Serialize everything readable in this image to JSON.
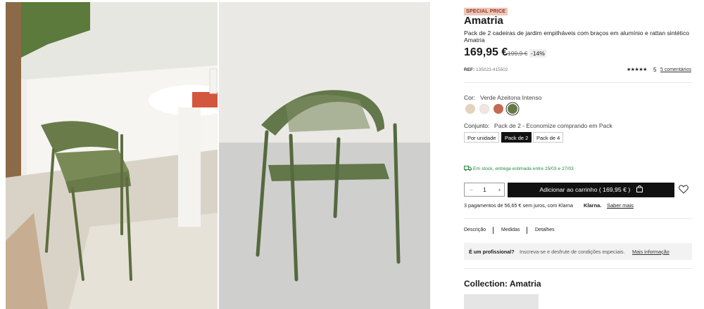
{
  "images": [
    {
      "name": "lifestyle-photo",
      "colors": {
        "sky": "#e9e8e3",
        "wall": "#f3f2ee",
        "floor": "#d8d3c8",
        "chair": "#6a7b4a"
      }
    },
    {
      "name": "studio-photo",
      "colors": {
        "backdrop": "#e8e6e2",
        "floor": "#cfcfce",
        "chair": "#62774a"
      }
    }
  ],
  "product": {
    "badge": "SPECIAL PRICE",
    "title": "Amatria",
    "subtitle": "Pack de 2 cadeiras de jardim empilháveis com braços em alumínio e rattan sintético Amatria",
    "price": "169,95 €",
    "old_price": "199,9 €",
    "discount": "-14%",
    "ref_label": "REF:",
    "ref_value": "135023-415502",
    "stars": "★★★★★",
    "rating": "5",
    "reviews": "5 comentários"
  },
  "color": {
    "label": "Cor:",
    "value": "Verde Azeitona Intenso",
    "swatches": [
      {
        "name": "beige",
        "hex": "#e3d3bc"
      },
      {
        "name": "cream",
        "hex": "#f3e6e2"
      },
      {
        "name": "terracotta",
        "hex": "#c56a52"
      },
      {
        "name": "olive-green",
        "hex": "#667a47",
        "selected": true
      }
    ]
  },
  "set": {
    "label": "Conjunto:",
    "value": "Pack de 2 - Economize comprando em Pack",
    "options": [
      "Por unidade",
      "Pack de 2",
      "Pack de 4"
    ],
    "selected": "Pack de 2"
  },
  "stock": {
    "text": "Em stock, entrega estimada entre 25/03 e 27/03",
    "color": "#1f8a3b"
  },
  "quantity": {
    "minus": "−",
    "value": "1",
    "plus": "+"
  },
  "cart": {
    "label": "Adicionar ao carrinho ( 169,95 € )"
  },
  "klarna": {
    "text": "3 pagamentos de 56,65 € sem juros, com Klarna",
    "logo": "Klarna.",
    "link": "Saber mais"
  },
  "tabs": [
    "Descrição",
    "Medidas",
    "Detalhes"
  ],
  "pro": {
    "question": "É um profissional?",
    "desc": "Inscreva-se e desfrute de condições especiais.",
    "link": "Mais informação"
  },
  "collection": {
    "title": "Collection: Amatria"
  },
  "colors": {
    "accent": "#111111",
    "badge_bg": "#e9c9bd",
    "badge_text": "#a3331d"
  }
}
